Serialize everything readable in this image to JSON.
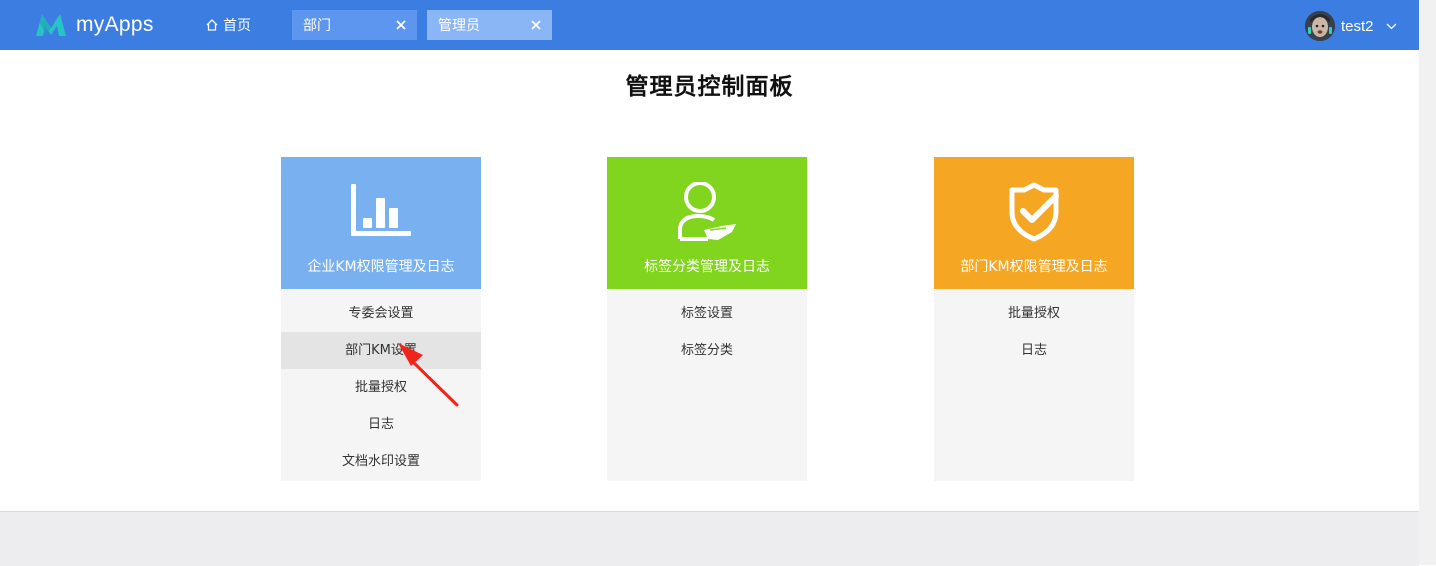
{
  "app": {
    "name": "myApps"
  },
  "nav": {
    "home_label": "首页",
    "tabs": [
      {
        "label": "部门"
      },
      {
        "label": "管理员"
      }
    ]
  },
  "user": {
    "name": "test2"
  },
  "page": {
    "title": "管理员控制面板"
  },
  "colors": {
    "topbar": "#3c7de2",
    "card_blue": "#79b0f0",
    "card_green": "#82d51f",
    "card_orange": "#f5a623",
    "annotation_arrow": "#f2241a"
  },
  "cards": [
    {
      "title": "企业KM权限管理及日志",
      "icon": "bar-chart-icon",
      "items": [
        {
          "label": "专委会设置"
        },
        {
          "label": "部门KM设置"
        },
        {
          "label": "批量授权"
        },
        {
          "label": "日志"
        },
        {
          "label": "文档水印设置"
        }
      ]
    },
    {
      "title": "标签分类管理及日志",
      "icon": "user-tag-icon",
      "items": [
        {
          "label": "标签设置"
        },
        {
          "label": "标签分类"
        }
      ]
    },
    {
      "title": "部门KM权限管理及日志",
      "icon": "shield-check-icon",
      "items": [
        {
          "label": "批量授权"
        },
        {
          "label": "日志"
        }
      ]
    }
  ]
}
